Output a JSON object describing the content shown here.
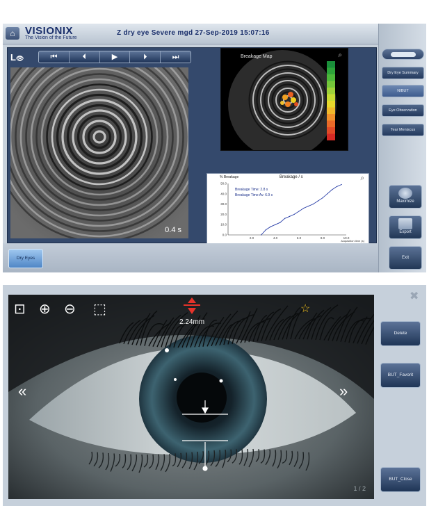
{
  "panel1": {
    "logo": {
      "name": "VISIONIX",
      "tagline": "The Vision of the Future"
    },
    "title": "Z dry eye  Severe mgd  27-Sep-2019  15:07:16",
    "eye_label": "L",
    "player": [
      "⏮",
      "⏴",
      "▶",
      "⏵",
      "⏭"
    ],
    "time": "0.4 s",
    "breakage_map": {
      "title": "Breakage Map"
    },
    "breakage_graph": {
      "unit_label": "% Breakage",
      "title": "Breakage / s",
      "legend": [
        "Breakage Time: 2.8 s",
        "Breakage Time Av: 6.9 s"
      ],
      "y_ticks": [
        "50.0",
        "40.0",
        "30.0",
        "20.0",
        "10.0",
        "0.0"
      ],
      "x_ticks": [
        "2.0",
        "4.0",
        "6.0",
        "8.0",
        "10.0"
      ],
      "x_label": "Acquisition time (s)"
    },
    "chart_data": {
      "type": "line",
      "title": "Breakage / s",
      "ylabel": "% Breakage",
      "xlabel": "Acquisition time (s)",
      "x": [
        2.8,
        3.2,
        3.6,
        4.0,
        4.4,
        4.8,
        5.2,
        5.6,
        6.0,
        6.4,
        6.8,
        7.2,
        7.6,
        8.0,
        8.4,
        8.8,
        9.2,
        9.6
      ],
      "values": [
        0,
        5,
        8,
        10,
        12,
        16,
        18,
        20,
        23,
        26,
        28,
        30,
        33,
        36,
        40,
        44,
        47,
        49
      ],
      "xlim": [
        0,
        10
      ],
      "ylim": [
        0,
        50
      ]
    },
    "sidebar": {
      "items": [
        "Dry Eye Summary",
        "NIBUT",
        "Eye Observation",
        "Tear Meniscus"
      ],
      "maximize": "Maximize",
      "export": "Export",
      "exit": "Exit"
    },
    "dry_eyes": "Dry Eyes",
    "colors": {
      "accent": "#2d4368",
      "highlight": "#4f86c6"
    }
  },
  "panel2": {
    "measurement": "2.24mm",
    "buttons": {
      "delete": "Delete",
      "favorite": "BUT_Favorit",
      "close": "BUT_Close"
    },
    "page": "1 / 2"
  }
}
